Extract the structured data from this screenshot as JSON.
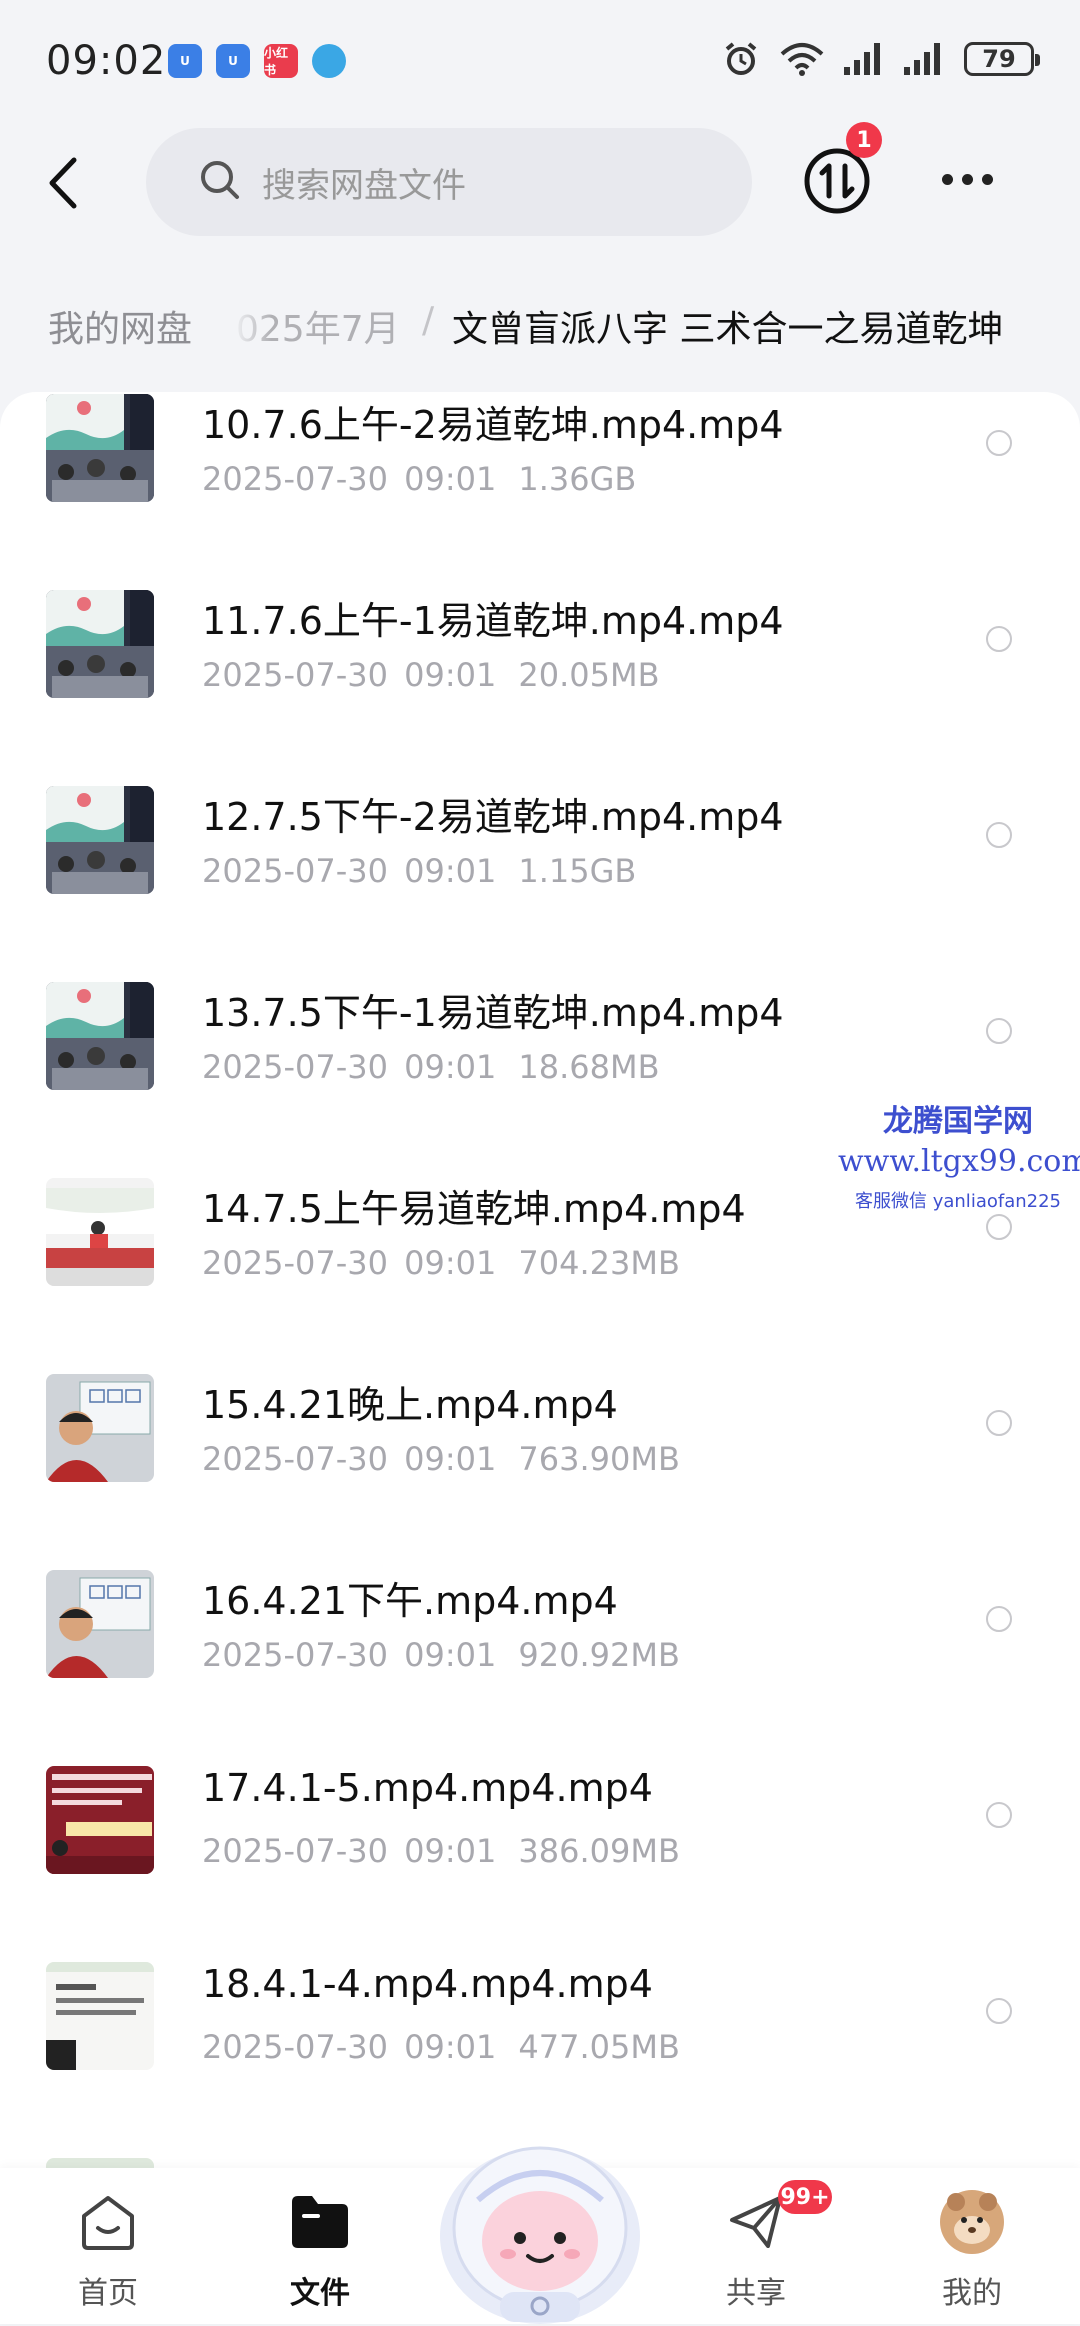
{
  "status_bar": {
    "time": "09:02",
    "apps": [
      {
        "icon": "u-app-icon",
        "color": "#3b7fe6",
        "text": "U"
      },
      {
        "icon": "u-app-icon",
        "color": "#3b7fe6",
        "text": "U"
      },
      {
        "icon": "xiaohongshu-icon",
        "color": "#ea3c4d",
        "text": "小红书"
      },
      {
        "icon": "telegram-icon",
        "color": "#3aa7e5",
        "text": ""
      }
    ],
    "battery": "79"
  },
  "header": {
    "search_placeholder": "搜索网盘文件",
    "transfer_badge": "1"
  },
  "breadcrumb": {
    "root": "我的网盘",
    "middle": "025年7月",
    "separator": "/",
    "current": "文曾盲派八字  三术合一之易道乾坤"
  },
  "files": [
    {
      "name": "10.7.6上午-2易道乾坤.mp4.mp4",
      "date": "2025-07-30  09:01",
      "size": "1.36GB",
      "thumb": "stage"
    },
    {
      "name": "11.7.6上午-1易道乾坤.mp4.mp4",
      "date": "2025-07-30  09:01",
      "size": "20.05MB",
      "thumb": "stage"
    },
    {
      "name": "12.7.5下午-2易道乾坤.mp4.mp4",
      "date": "2025-07-30  09:01",
      "size": "1.15GB",
      "thumb": "stage"
    },
    {
      "name": "13.7.5下午-1易道乾坤.mp4.mp4",
      "date": "2025-07-30  09:01",
      "size": "18.68MB",
      "thumb": "stage"
    },
    {
      "name": "14.7.5上午易道乾坤.mp4.mp4",
      "date": "2025-07-30  09:01",
      "size": "704.23MB",
      "thumb": "podium"
    },
    {
      "name": "15.4.21晚上.mp4.mp4",
      "date": "2025-07-30  09:01",
      "size": "763.90MB",
      "thumb": "person"
    },
    {
      "name": "16.4.21下午.mp4.mp4",
      "date": "2025-07-30  09:01",
      "size": "920.92MB",
      "thumb": "person"
    },
    {
      "name": "17.4.1-5.mp4.mp4.mp4",
      "date": "2025-07-30  09:01",
      "size": "386.09MB",
      "thumb": "slide-red"
    },
    {
      "name": "18.4.1-4.mp4.mp4.mp4",
      "date": "2025-07-30  09:01",
      "size": "477.05MB",
      "thumb": "slide-white"
    }
  ],
  "watermark": {
    "line1": "龙腾国学网",
    "line2": "www.ltgx99.com",
    "line3": "客服微信 yanliaofan225"
  },
  "bottom_nav": {
    "home": "首页",
    "files": "文件",
    "share": "共享",
    "share_badge": "99+",
    "mine": "我的"
  }
}
